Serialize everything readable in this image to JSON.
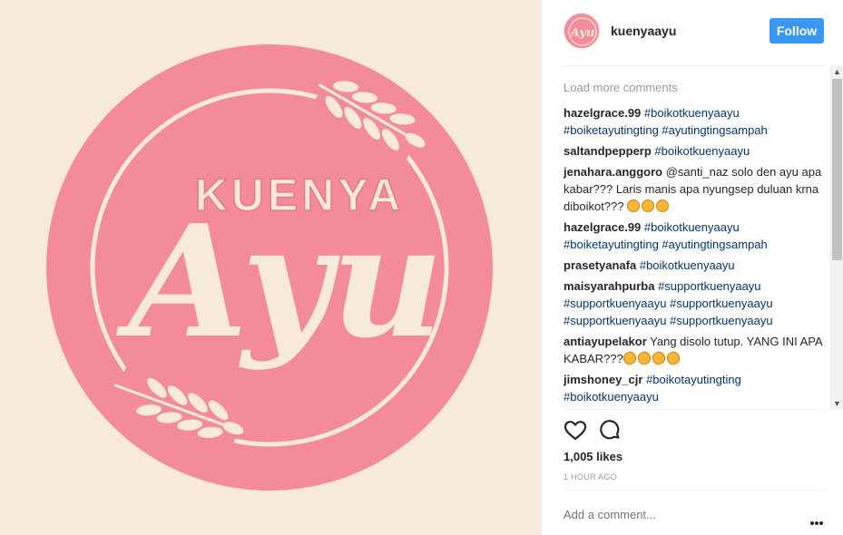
{
  "post": {
    "logo_top_text": "KUENYA",
    "logo_script_text": "Ayu",
    "colors": {
      "background": "#f8eadb",
      "circle": "#f38b9a",
      "cream": "#f8eadb"
    }
  },
  "header": {
    "avatar_text": "Ayu",
    "username": "kuenyaayu",
    "follow_label": "Follow"
  },
  "comments": {
    "load_more": "Load more comments",
    "items": [
      {
        "author": "hazelgrace.99",
        "text": "",
        "tags": "#boikotkuenyaayu #boiketayutingting #ayutingtingsampah"
      },
      {
        "author": "saltandpepperp",
        "text": "",
        "tags": "#boikotkuenyaayu"
      },
      {
        "author": "jenahara.anggoro",
        "text": "@santi_naz solo den ayu apa kabar??? Laris manis apa nyungsep duluan krna diboikot???",
        "tags": ""
      },
      {
        "author": "hazelgrace.99",
        "text": "",
        "tags": "#boikotkuenyaayu #boiketayutingting #ayutingtingsampah"
      },
      {
        "author": "prasetyanafa",
        "text": "",
        "tags": "#boikotkuenyaayu"
      },
      {
        "author": "maisyarahpurba",
        "text": "",
        "tags": "#supportkuenyaayu #supportkuenyaayu #supportkuenyaayu #supportkuenyaayu #supportkuenyaayu"
      },
      {
        "author": "antiayupelakor",
        "text": "Yang disolo tutup. YANG INI APA KABAR???",
        "tags": ""
      },
      {
        "author": "jimshoney_cjr",
        "text": "",
        "tags": "#boikotayutingting #boikotkuenyaayu"
      }
    ]
  },
  "icons": {
    "like": "heart-icon",
    "comment": "comment-bubble-icon",
    "more": "more-options-icon"
  },
  "likes_text": "1,005 likes",
  "time_text": "1 HOUR AGO",
  "comment_input": {
    "placeholder": "Add a comment...",
    "value": ""
  },
  "scroll": {
    "up": "▲",
    "down": "▼"
  },
  "colors": {
    "follow": "#3897f0",
    "hashtag": "#003569",
    "muted": "#999999"
  }
}
